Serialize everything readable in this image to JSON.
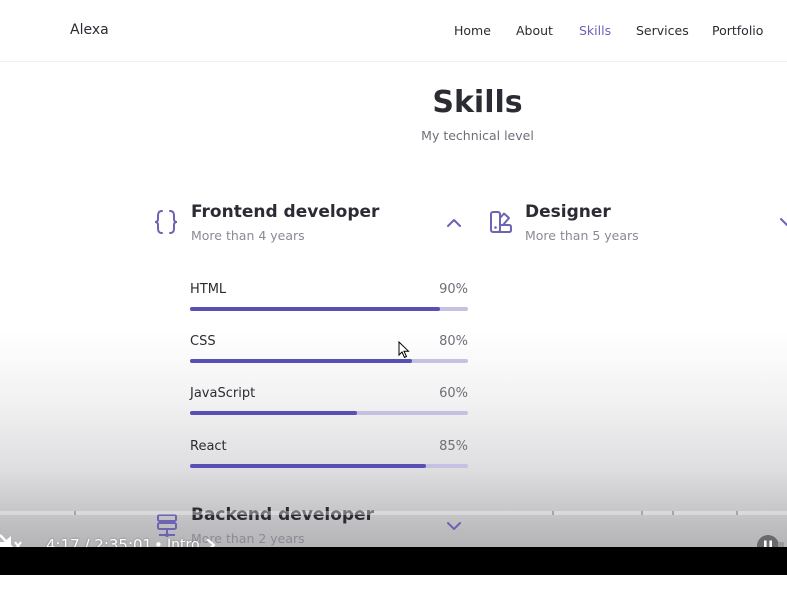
{
  "navbar": {
    "brand": "Alexa",
    "links": [
      {
        "label": "Home",
        "active": false
      },
      {
        "label": "About",
        "active": false
      },
      {
        "label": "Skills",
        "active": true
      },
      {
        "label": "Services",
        "active": false
      },
      {
        "label": "Portfolio",
        "active": false
      }
    ]
  },
  "section": {
    "title": "Skills",
    "subtitle": "My technical level"
  },
  "categories": [
    {
      "icon": "braces-icon",
      "title": "Frontend developer",
      "subtitle": "More than 4 years",
      "expanded": true,
      "skills": [
        {
          "name": "HTML",
          "percent_label": "90%",
          "level": 0.9
        },
        {
          "name": "CSS",
          "percent_label": "80%",
          "level": 0.8
        },
        {
          "name": "JavaScript",
          "percent_label": "60%",
          "level": 0.6
        },
        {
          "name": "React",
          "percent_label": "85%",
          "level": 0.85
        }
      ]
    },
    {
      "icon": "swatchbook-icon",
      "title": "Designer",
      "subtitle": "More than 5 years",
      "expanded": false
    },
    {
      "icon": "server-icon",
      "title": "Backend developer",
      "subtitle": "More than 2 years",
      "expanded": false
    }
  ],
  "video_player": {
    "time": "4:17 / 2:35:01",
    "separator": "•",
    "chapter": "Intro",
    "muted": true,
    "state": "playing"
  },
  "colors": {
    "accent": "#6c63b3",
    "bar_fill": "#5a4fb5",
    "bar_track": "#c4c1e3",
    "text": "#2b2b33"
  }
}
